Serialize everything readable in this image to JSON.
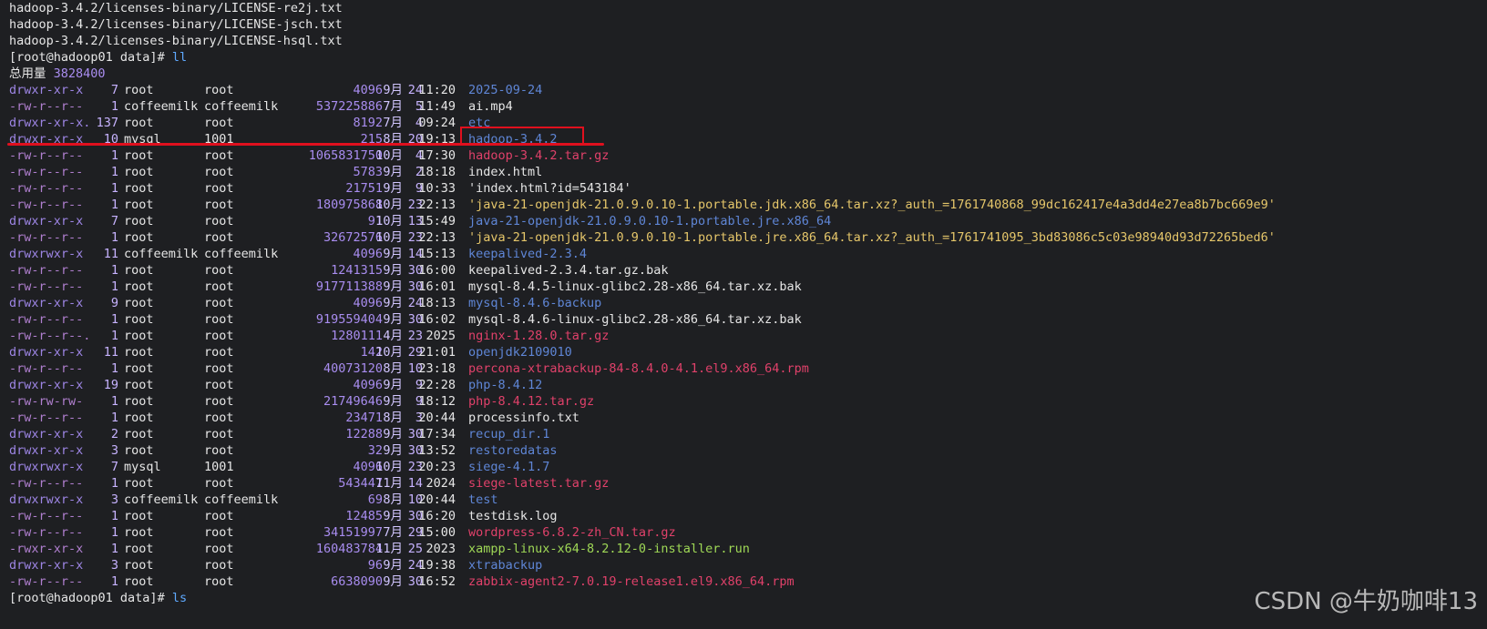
{
  "tar_output": [
    "hadoop-3.4.2/licenses-binary/LICENSE-re2j.txt",
    "hadoop-3.4.2/licenses-binary/LICENSE-jsch.txt",
    "hadoop-3.4.2/licenses-binary/LICENSE-hsql.txt"
  ],
  "prompt1": {
    "prefix": "[root@hadoop01 data]",
    "hash": "#",
    "command": " ll"
  },
  "total": {
    "label": "总用量",
    "value": "3828400"
  },
  "entries": [
    {
      "perm": "drwxr-xr-x",
      "links": "7",
      "owner": "root",
      "group": "root",
      "size": "4096",
      "month": "9月",
      "day": "24",
      "time": "11:20",
      "name": "2025-09-24",
      "kind": "dir"
    },
    {
      "perm": "-rw-r--r--",
      "links": "1",
      "owner": "coffeemilk",
      "group": "coffeemilk",
      "size": "537225886",
      "month": "7月",
      "day": "5",
      "time": "11:49",
      "name": "ai.mp4",
      "kind": "plain"
    },
    {
      "perm": "drwxr-xr-x.",
      "links": "137",
      "owner": "root",
      "group": "root",
      "size": "8192",
      "month": "7月",
      "day": "4",
      "time": "09:24",
      "name": "etc",
      "kind": "dir"
    },
    {
      "perm": "drwxr-xr-x",
      "links": "10",
      "owner": "mysql",
      "group": "1001",
      "size": "215",
      "month": "8月",
      "day": "20",
      "time": "19:13",
      "name": "hadoop-3.4.2",
      "kind": "dir"
    },
    {
      "perm": "-rw-r--r--",
      "links": "1",
      "owner": "root",
      "group": "root",
      "size": "1065831750",
      "month": "10月",
      "day": "4",
      "time": "17:30",
      "name": "hadoop-3.4.2.tar.gz",
      "kind": "archive"
    },
    {
      "perm": "-rw-r--r--",
      "links": "1",
      "owner": "root",
      "group": "root",
      "size": "5783",
      "month": "9月",
      "day": "2",
      "time": "18:18",
      "name": "index.html",
      "kind": "plain"
    },
    {
      "perm": "-rw-r--r--",
      "links": "1",
      "owner": "root",
      "group": "root",
      "size": "21751",
      "month": "9月",
      "day": "9",
      "time": "10:33",
      "name": "'index.html?id=543184'",
      "kind": "plain"
    },
    {
      "perm": "-rw-r--r--",
      "links": "1",
      "owner": "root",
      "group": "root",
      "size": "180975868",
      "month": "10月",
      "day": "23",
      "time": "22:13",
      "name": "'java-21-openjdk-21.0.9.0.10-1.portable.jdk.x86_64.tar.xz?_auth_=1761740868_99dc162417e4a3dd4e27ea8b7bc669e9'",
      "kind": "quoted"
    },
    {
      "perm": "drwxr-xr-x",
      "links": "7",
      "owner": "root",
      "group": "root",
      "size": "91",
      "month": "10月",
      "day": "13",
      "time": "15:49",
      "name": "java-21-openjdk-21.0.9.0.10-1.portable.jre.x86_64",
      "kind": "dir"
    },
    {
      "perm": "-rw-r--r--",
      "links": "1",
      "owner": "root",
      "group": "root",
      "size": "32672576",
      "month": "10月",
      "day": "23",
      "time": "22:13",
      "name": "'java-21-openjdk-21.0.9.0.10-1.portable.jre.x86_64.tar.xz?_auth_=1761741095_3bd83086c5c03e98940d93d72265bed6'",
      "kind": "quoted"
    },
    {
      "perm": "drwxrwxr-x",
      "links": "11",
      "owner": "coffeemilk",
      "group": "coffeemilk",
      "size": "4096",
      "month": "9月",
      "day": "14",
      "time": "15:13",
      "name": "keepalived-2.3.4",
      "kind": "dir"
    },
    {
      "perm": "-rw-r--r--",
      "links": "1",
      "owner": "root",
      "group": "root",
      "size": "1241315",
      "month": "9月",
      "day": "30",
      "time": "16:00",
      "name": "keepalived-2.3.4.tar.gz.bak",
      "kind": "plain"
    },
    {
      "perm": "-rw-r--r--",
      "links": "1",
      "owner": "root",
      "group": "root",
      "size": "917711388",
      "month": "9月",
      "day": "30",
      "time": "16:01",
      "name": "mysql-8.4.5-linux-glibc2.28-x86_64.tar.xz.bak",
      "kind": "plain"
    },
    {
      "perm": "drwxr-xr-x",
      "links": "9",
      "owner": "root",
      "group": "root",
      "size": "4096",
      "month": "9月",
      "day": "24",
      "time": "18:13",
      "name": "mysql-8.4.6-backup",
      "kind": "dir"
    },
    {
      "perm": "-rw-r--r--",
      "links": "1",
      "owner": "root",
      "group": "root",
      "size": "919559404",
      "month": "9月",
      "day": "30",
      "time": "16:02",
      "name": "mysql-8.4.6-linux-glibc2.28-x86_64.tar.xz.bak",
      "kind": "plain"
    },
    {
      "perm": "-rw-r--r--.",
      "links": "1",
      "owner": "root",
      "group": "root",
      "size": "1280111",
      "month": "4月",
      "day": "23",
      "time": "2025",
      "name": "nginx-1.28.0.tar.gz",
      "kind": "archive"
    },
    {
      "perm": "drwxr-xr-x",
      "links": "11",
      "owner": "root",
      "group": "root",
      "size": "142",
      "month": "10月",
      "day": "29",
      "time": "21:01",
      "name": "openjdk2109010",
      "kind": "dir"
    },
    {
      "perm": "-rw-r--r--",
      "links": "1",
      "owner": "root",
      "group": "root",
      "size": "40073120",
      "month": "8月",
      "day": "10",
      "time": "23:18",
      "name": "percona-xtrabackup-84-8.4.0-4.1.el9.x86_64.rpm",
      "kind": "archive"
    },
    {
      "perm": "drwxr-xr-x",
      "links": "19",
      "owner": "root",
      "group": "root",
      "size": "4096",
      "month": "9月",
      "day": "9",
      "time": "22:28",
      "name": "php-8.4.12",
      "kind": "dir"
    },
    {
      "perm": "-rw-rw-rw-",
      "links": "1",
      "owner": "root",
      "group": "root",
      "size": "21749646",
      "month": "9月",
      "day": "9",
      "time": "18:12",
      "name": "php-8.4.12.tar.gz",
      "kind": "archive"
    },
    {
      "perm": "-rw-r--r--",
      "links": "1",
      "owner": "root",
      "group": "root",
      "size": "23471",
      "month": "8月",
      "day": "3",
      "time": "20:44",
      "name": "processinfo.txt",
      "kind": "plain"
    },
    {
      "perm": "drwxr-xr-x",
      "links": "2",
      "owner": "root",
      "group": "root",
      "size": "12288",
      "month": "9月",
      "day": "30",
      "time": "17:34",
      "name": "recup_dir.1",
      "kind": "dir"
    },
    {
      "perm": "drwxr-xr-x",
      "links": "3",
      "owner": "root",
      "group": "root",
      "size": "32",
      "month": "9月",
      "day": "30",
      "time": "13:52",
      "name": "restoredatas",
      "kind": "dir"
    },
    {
      "perm": "drwxrwxr-x",
      "links": "7",
      "owner": "mysql",
      "group": "1001",
      "size": "4096",
      "month": "10月",
      "day": "23",
      "time": "20:23",
      "name": "siege-4.1.7",
      "kind": "dir"
    },
    {
      "perm": "-rw-r--r--",
      "links": "1",
      "owner": "root",
      "group": "root",
      "size": "543447",
      "month": "11月",
      "day": "14",
      "time": "2024",
      "name": "siege-latest.tar.gz",
      "kind": "archive"
    },
    {
      "perm": "drwxrwxr-x",
      "links": "3",
      "owner": "coffeemilk",
      "group": "coffeemilk",
      "size": "69",
      "month": "8月",
      "day": "10",
      "time": "20:44",
      "name": "test",
      "kind": "dir"
    },
    {
      "perm": "-rw-r--r--",
      "links": "1",
      "owner": "root",
      "group": "root",
      "size": "12485",
      "month": "9月",
      "day": "30",
      "time": "16:20",
      "name": "testdisk.log",
      "kind": "plain"
    },
    {
      "perm": "-rw-r--r--",
      "links": "1",
      "owner": "root",
      "group": "root",
      "size": "34151997",
      "month": "7月",
      "day": "29",
      "time": "15:00",
      "name": "wordpress-6.8.2-zh_CN.tar.gz",
      "kind": "archive"
    },
    {
      "perm": "-rwxr-xr-x",
      "links": "1",
      "owner": "root",
      "group": "root",
      "size": "160483784",
      "month": "11月",
      "day": "25",
      "time": "2023",
      "name": "xampp-linux-x64-8.2.12-0-installer.run",
      "kind": "exec"
    },
    {
      "perm": "drwxr-xr-x",
      "links": "3",
      "owner": "root",
      "group": "root",
      "size": "96",
      "month": "9月",
      "day": "24",
      "time": "19:38",
      "name": "xtrabackup",
      "kind": "dir"
    },
    {
      "perm": "-rw-r--r--",
      "links": "1",
      "owner": "root",
      "group": "root",
      "size": "6638090",
      "month": "9月",
      "day": "30",
      "time": "16:52",
      "name": "zabbix-agent2-7.0.19-release1.el9.x86_64.rpm",
      "kind": "archive"
    }
  ],
  "prompt2": {
    "prefix": "[root@hadoop01 data]",
    "hash": "#",
    "command": " ls"
  },
  "watermark": "CSDN @牛奶咖啡13",
  "colors": {
    "background": "#1e1f22",
    "directory": "#5f86d6",
    "archive": "#e0416a",
    "quoted": "#e5c66a",
    "executable": "#9fd856",
    "highlight": "#e0101e"
  }
}
